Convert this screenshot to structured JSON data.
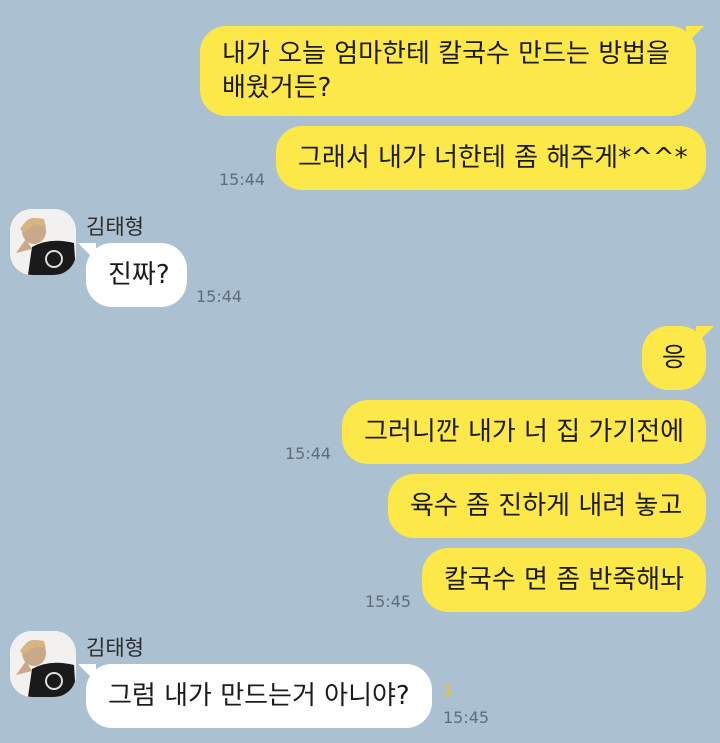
{
  "colors": {
    "background": "#abc1d1",
    "my_bubble": "#fde84a",
    "friend_bubble": "#ffffff",
    "timestamp": "#5e6e7a",
    "unread": "#e2c63f"
  },
  "friend": {
    "name": "김태형",
    "avatar_icon": "profile-photo-icon"
  },
  "messages": [
    {
      "sender": "me",
      "lines": [
        "내가 오늘 엄마한테 칼국수 만드는 방법을",
        "배웠거든?"
      ]
    },
    {
      "sender": "me",
      "text": "그래서 내가 너한테 좀 해주게*^^*",
      "time": "15:44"
    },
    {
      "sender": "friend",
      "text": "진짜?",
      "time": "15:44"
    },
    {
      "sender": "me",
      "text": "응"
    },
    {
      "sender": "me",
      "text": "그러니깐 내가 너 집 가기전에",
      "time": "15:44"
    },
    {
      "sender": "me",
      "text": "육수 좀 진하게 내려 놓고"
    },
    {
      "sender": "me",
      "text": "칼국수 면 좀 반죽해놔",
      "time": "15:45"
    },
    {
      "sender": "friend",
      "text": "그럼 내가 만드는거 아니야?",
      "time": "15:45",
      "unread_count": "1"
    }
  ]
}
